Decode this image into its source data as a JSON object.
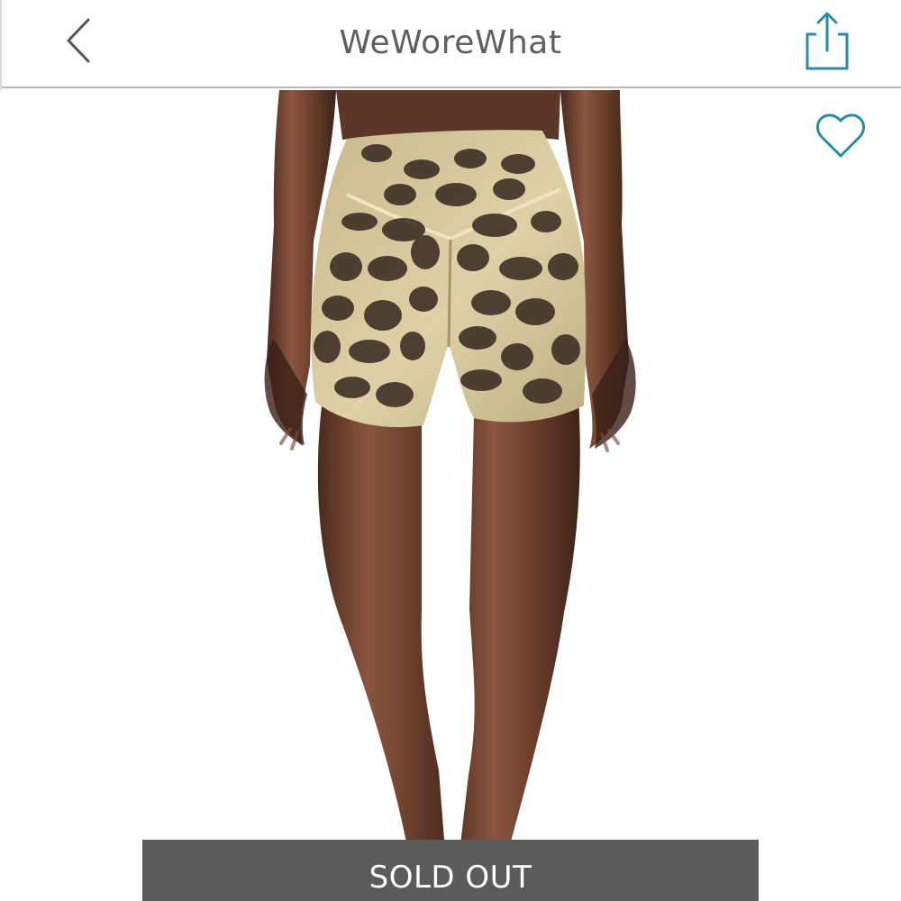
{
  "header": {
    "title": "WeWoreWhat",
    "back_icon": "chevron-left-icon",
    "share_icon": "share-icon",
    "accent_color": "#2d8aa3"
  },
  "product": {
    "favorite_icon": "heart-icon",
    "status_label": "SOLD OUT"
  }
}
